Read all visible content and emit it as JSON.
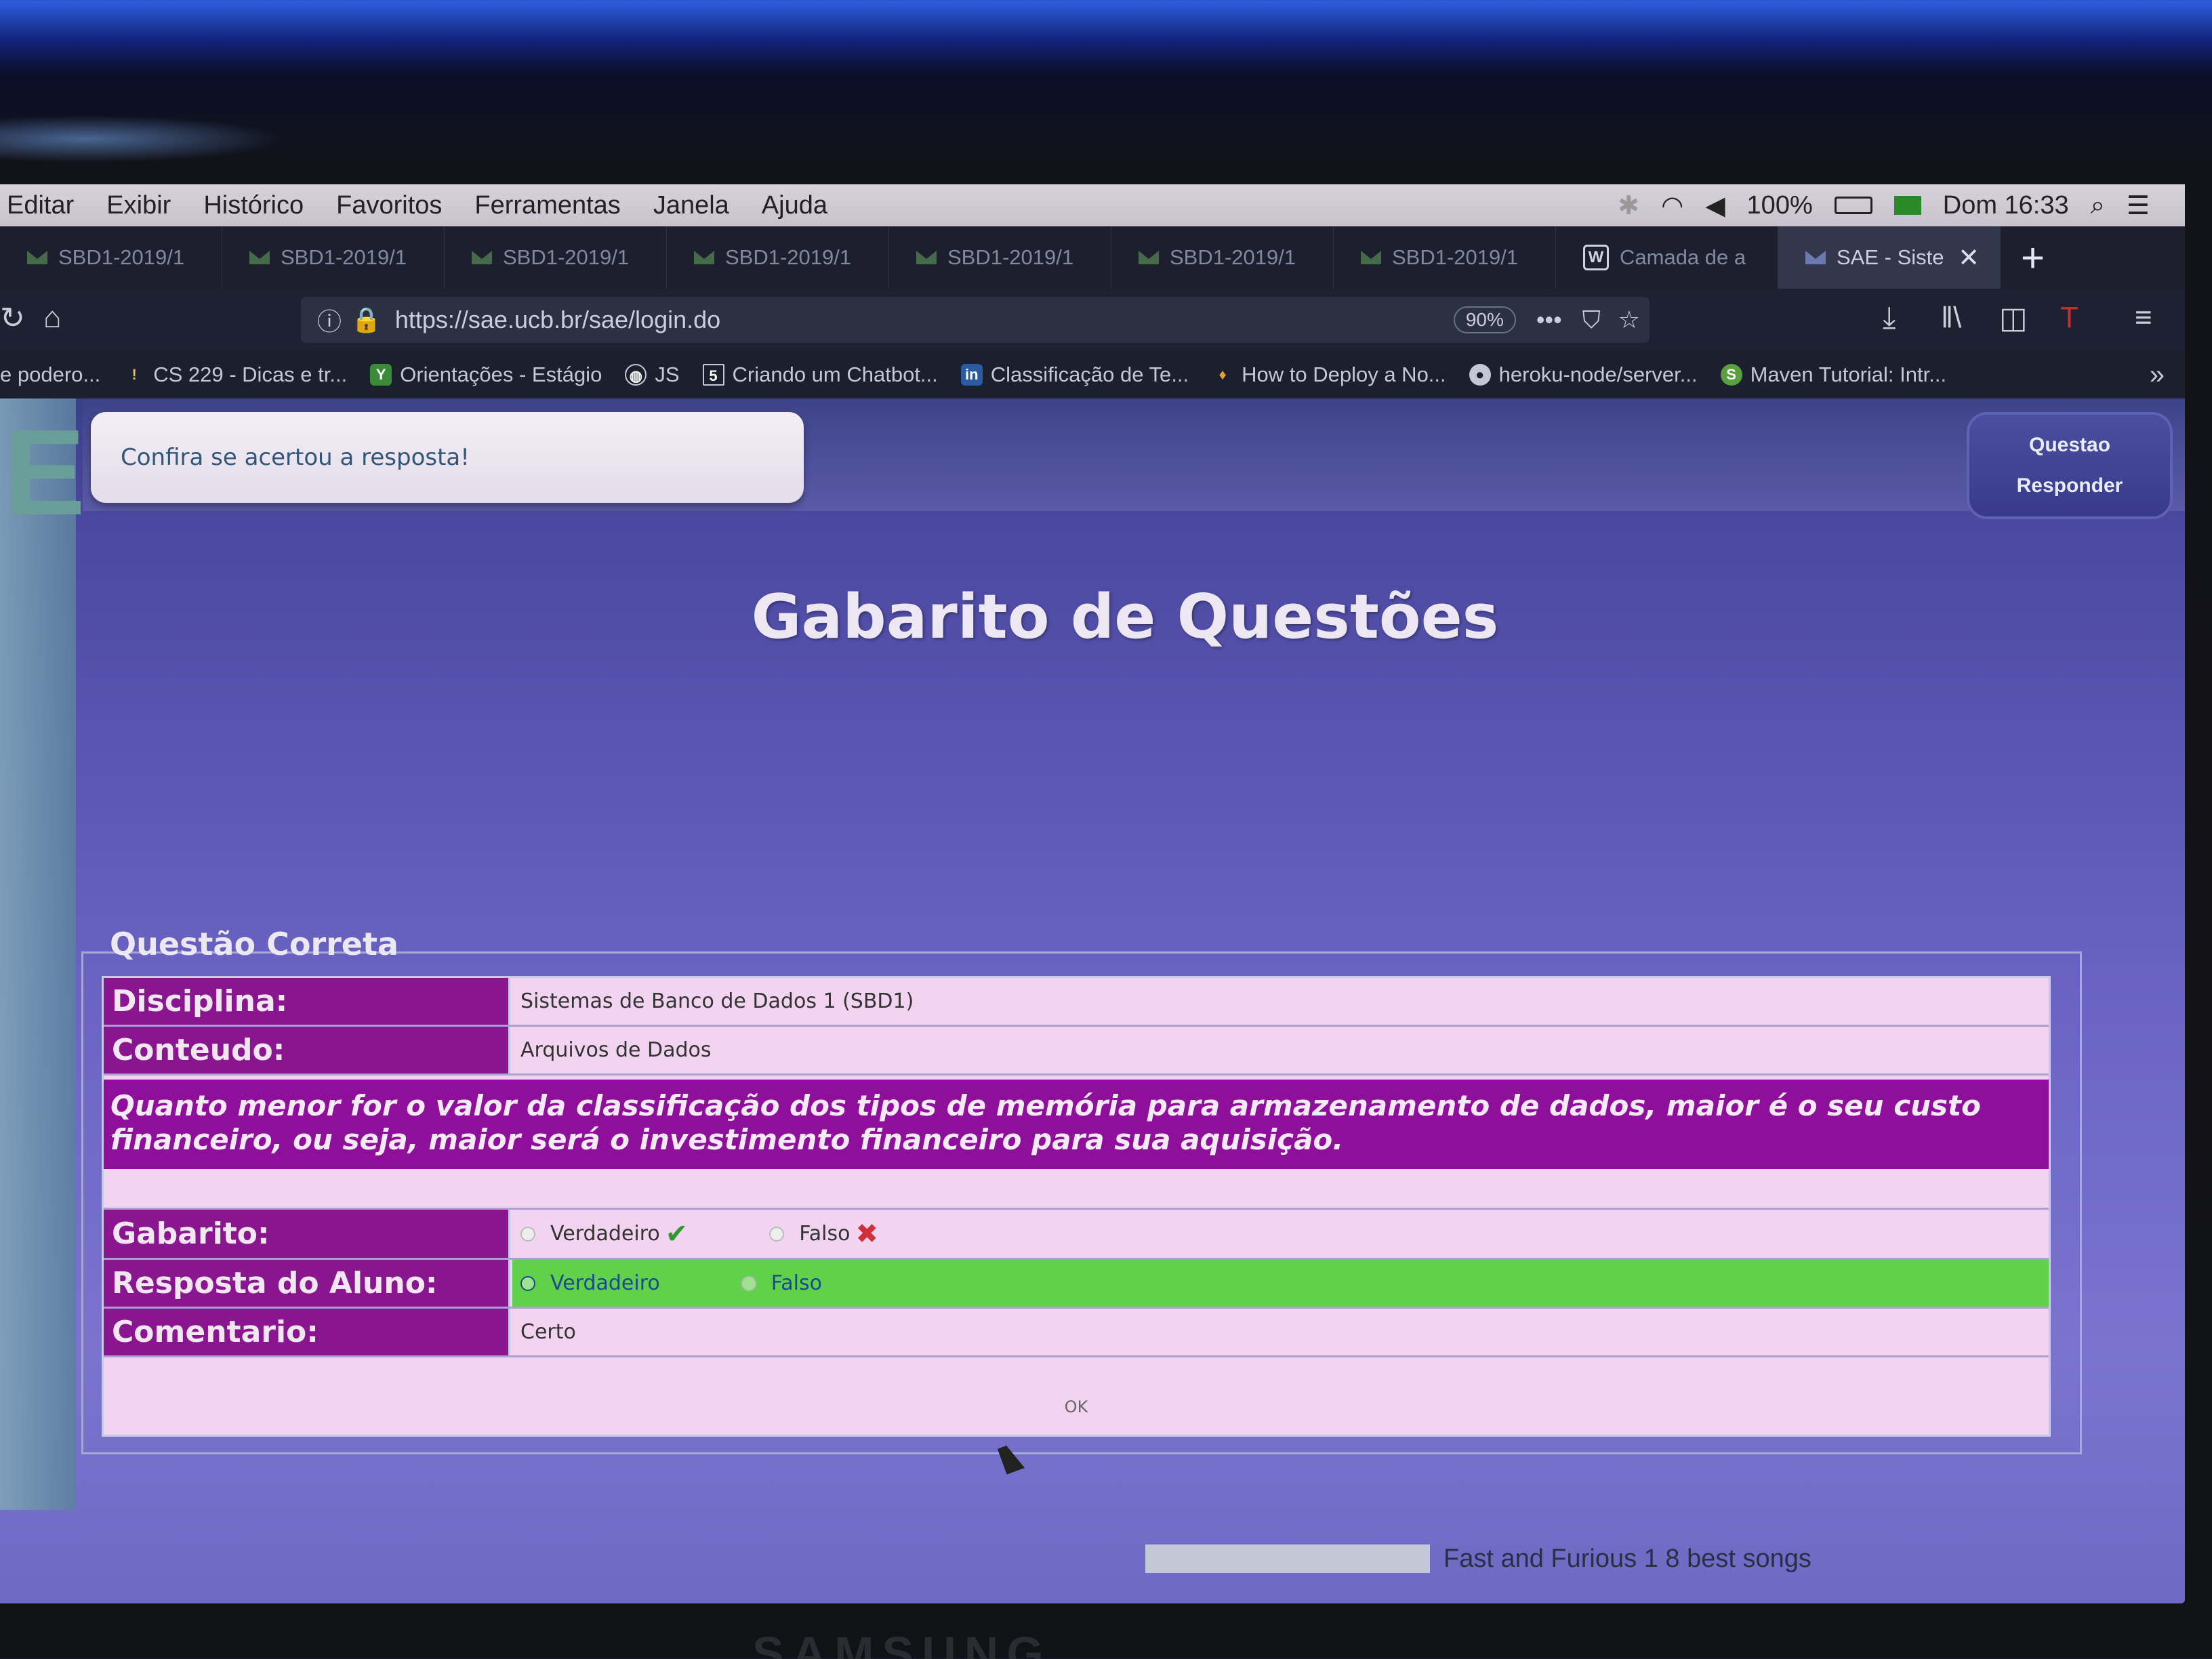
{
  "menubar": {
    "items": [
      "Editar",
      "Exibir",
      "Histórico",
      "Favoritos",
      "Ferramentas",
      "Janela",
      "Ajuda"
    ],
    "battery": "100%",
    "clock": "Dom 16:33"
  },
  "tabs": [
    {
      "label": "SBD1-2019/1"
    },
    {
      "label": "SBD1-2019/1"
    },
    {
      "label": "SBD1-2019/1"
    },
    {
      "label": "SBD1-2019/1"
    },
    {
      "label": "SBD1-2019/1"
    },
    {
      "label": "SBD1-2019/1"
    },
    {
      "label": "SBD1-2019/1"
    },
    {
      "label": "Camada de a"
    },
    {
      "label": "SAE - Siste"
    }
  ],
  "navbar": {
    "url": "https://sae.ucb.br/sae/login.do",
    "zoom": "90%"
  },
  "bookmarks": [
    "e podero...",
    "CS 229 - Dicas e tr...",
    "Orientações - Estágio",
    "JS",
    "Criando um Chatbot...",
    "Classificação de Te...",
    "How to Deploy a No...",
    "heroku-node/server...",
    "Maven Tutorial: Intr..."
  ],
  "page": {
    "message": "Confira se acertou a resposta!",
    "btn_questao": "Questao",
    "btn_responder": "Responder",
    "title": "Gabarito de Questões",
    "legend": "Questão Correta",
    "disciplina_label": "Disciplina:",
    "disciplina_value": "Sistemas de Banco de Dados 1 (SBD1)",
    "conteudo_label": "Conteudo:",
    "conteudo_value": "Arquivos de Dados",
    "question": "Quanto menor for o valor da classificação dos tipos de memória para armazenamento de dados, maior é o seu custo financeiro, ou seja, maior será o investimento financeiro para sua aquisição.",
    "gabarito_label": "Gabarito:",
    "opt_verdadeiro": "Verdadeiro",
    "opt_falso": "Falso",
    "resposta_label": "Resposta do Aluno:",
    "comentario_label": "Comentario:",
    "comentario_value": "Certo",
    "ok": "OK"
  },
  "taskbar": {
    "text": "Fast and Furious 1 8 best songs"
  },
  "monitor_brand": "SAMSUNG",
  "colors": {
    "label_bg": "#8a168f",
    "answer_green": "#5fd14a",
    "question_bg": "#8e0f9a"
  }
}
